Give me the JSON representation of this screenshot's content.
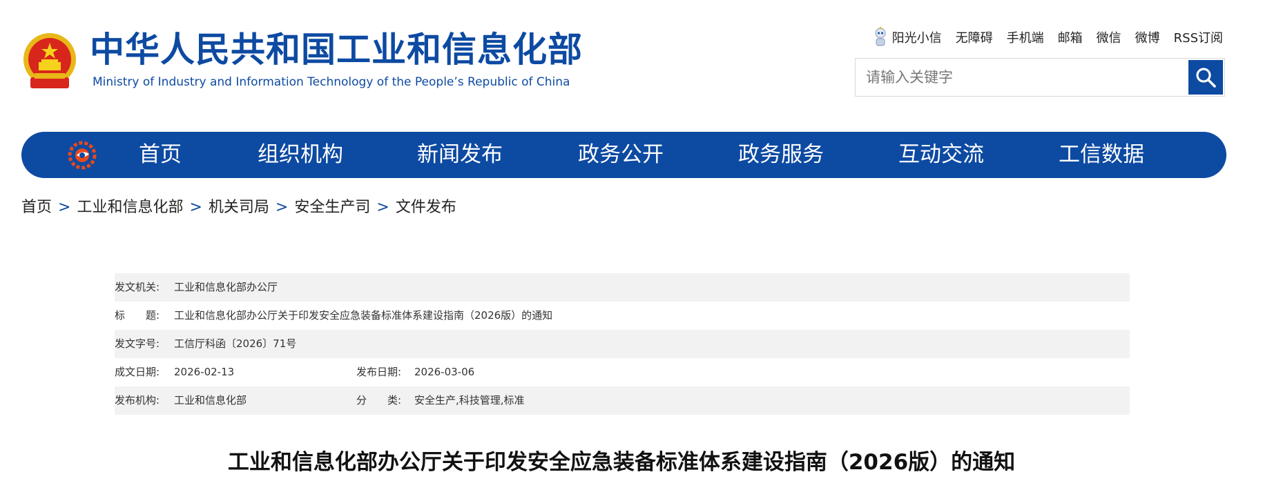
{
  "header": {
    "ministry_cn": "中华人民共和国工业和信息化部",
    "ministry_en": "Ministry of Industry and Information Technology of the People’s Republic of China",
    "emblem_icon": "national-emblem-icon",
    "brand_color": "#0d4aa2"
  },
  "toplinks": {
    "sunshine": "阳光小信",
    "accessibility": "无障碍",
    "mobile": "手机端",
    "mail": "邮箱",
    "wechat": "微信",
    "weibo": "微博",
    "rss": "RSS订阅"
  },
  "search": {
    "placeholder": "请输入关键字",
    "value": "",
    "button_icon": "search-icon"
  },
  "nav": {
    "logo_icon": "miit-logo-icon",
    "items": [
      "首页",
      "组织机构",
      "新闻发布",
      "政务公开",
      "政务服务",
      "互动交流",
      "工信数据"
    ]
  },
  "breadcrumb": [
    "首页",
    "工业和信息化部",
    "机关司局",
    "安全生产司",
    "文件发布"
  ],
  "meta": {
    "issuer_label": "发文机关:",
    "issuer": "工业和信息化部办公厅",
    "title_label": "标　　题:",
    "title": "工业和信息化部办公厅关于印发安全应急装备标准体系建设指南（2026版）的通知",
    "docno_label": "发文字号:",
    "docno": "工信厅科函〔2026〕71号",
    "written_label": "成文日期:",
    "written": "2026-02-13",
    "published_label": "发布日期:",
    "published": "2026-03-06",
    "agency_label": "发布机构:",
    "agency": "工业和信息化部",
    "category_label": "分　　类:",
    "category": "安全生产,科技管理,标准"
  },
  "article": {
    "title": "工业和信息化部办公厅关于印发安全应急装备标准体系建设指南（2026版）的通知"
  }
}
